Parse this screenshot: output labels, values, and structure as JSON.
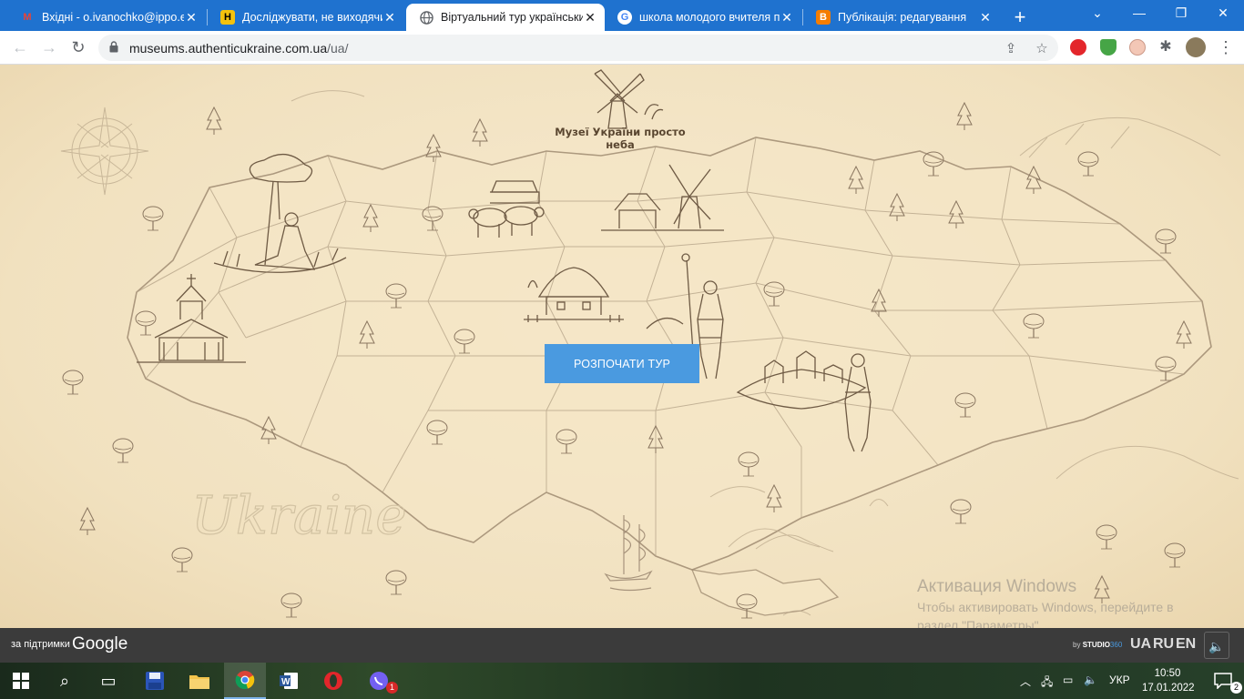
{
  "tabs": [
    {
      "title": "Вхідні - o.ivanochko@ippo.e",
      "favicon": "gmail-icon",
      "color": "#ea4335"
    },
    {
      "title": "Досліджувати, не виходячи",
      "favicon": "h-icon",
      "color": "#f4c20d"
    },
    {
      "title": "Віртуальний тур українськи",
      "favicon": "globe-icon",
      "color": "#5f6368"
    },
    {
      "title": "школа молодого вчителя п",
      "favicon": "google-icon",
      "color": "#4285f4"
    },
    {
      "title": "Публікація: редагування",
      "favicon": "blogger-icon",
      "color": "#f57d00"
    }
  ],
  "address": {
    "host": "museums.authenticukraine.com.ua",
    "path": "/ua/"
  },
  "page": {
    "site_title": "Музеї України просто неба",
    "start_button": "РОЗПОЧАТИ ТУР",
    "map_watermark": "Ukraine"
  },
  "windows_watermark": {
    "title": "Активация Windows",
    "text": "Чтобы активировать Windows, перейдите в раздел \"Параметры\"."
  },
  "sitebar": {
    "powered_by": "за підтримки",
    "google": "Google",
    "studio_by": "by",
    "studio_name": "STUDIO",
    "studio_num": "360",
    "languages": [
      "UA",
      "RU",
      "EN"
    ]
  },
  "taskbar": {
    "keyboard_lang": "УКР",
    "time": "10:50",
    "date": "17.01.2022",
    "notifications": "2",
    "viber_badge": "1"
  }
}
